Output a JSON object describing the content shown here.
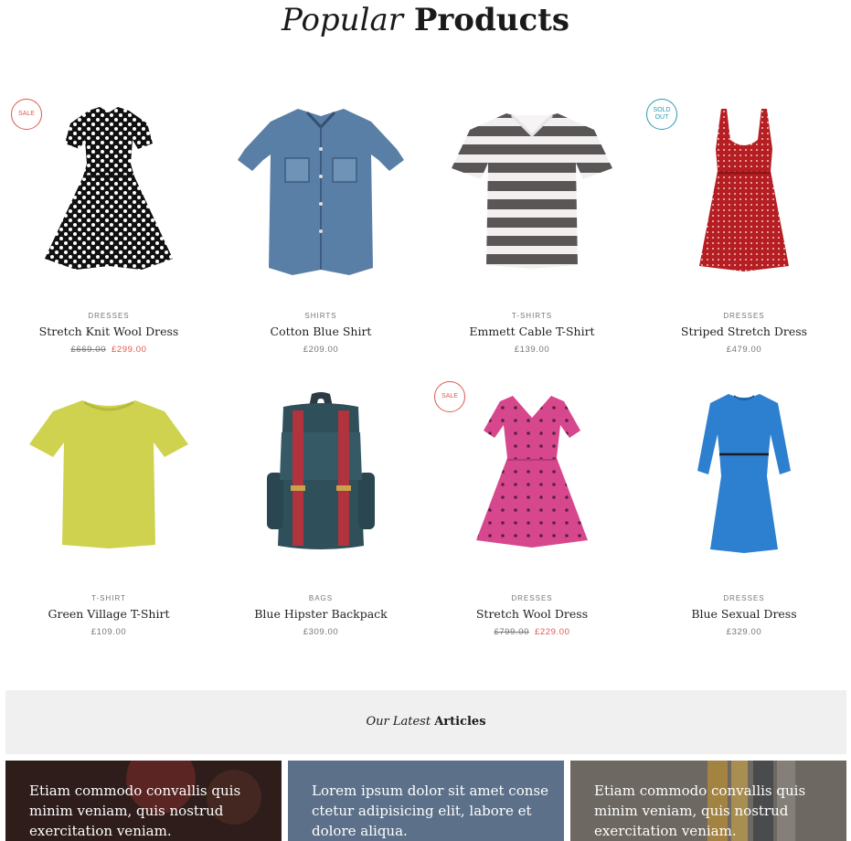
{
  "header": {
    "title_italic": "Popular",
    "title_bold": "Products"
  },
  "products": [
    {
      "category": "DRESSES",
      "name": "Stretch Knit Wool Dress",
      "old_price": "£669.00",
      "price": "£299.00",
      "badge": "SALE",
      "image": "polka-dot-dress-icon"
    },
    {
      "category": "SHIRTS",
      "name": "Cotton Blue Shirt",
      "price": "£209.00",
      "image": "denim-shirt-icon"
    },
    {
      "category": "T-SHIRTS",
      "name": "Emmett Cable T-Shirt",
      "price": "£139.00",
      "image": "striped-tshirt-icon"
    },
    {
      "category": "DRESSES",
      "name": "Striped Stretch Dress",
      "price": "£479.00",
      "badge": "SOLD OUT",
      "image": "red-dress-icon"
    },
    {
      "category": "T-SHIRT",
      "name": "Green Village T-Shirt",
      "price": "£109.00",
      "image": "yellow-tshirt-icon"
    },
    {
      "category": "BAGS",
      "name": "Blue Hipster Backpack",
      "price": "£309.00",
      "image": "backpack-icon"
    },
    {
      "category": "DRESSES",
      "name": "Stretch Wool Dress",
      "old_price": "£799.00",
      "price": "£229.00",
      "badge": "SALE",
      "image": "pink-dress-icon"
    },
    {
      "category": "DRESSES",
      "name": "Blue Sexual Dress",
      "price": "£329.00",
      "image": "blue-dress-icon"
    }
  ],
  "articles_section": {
    "title_italic": "Our Latest",
    "title_bold": "Articles"
  },
  "articles": [
    {
      "text": "Etiam commodo convallis quis minim veniam, quis nostrud exercitation veniam.",
      "background": "#3a2420"
    },
    {
      "text": "Lorem ipsum dolor sit amet conse ctetur adipisicing elit, labore et dolore aliqua.",
      "background": "#5c7189"
    },
    {
      "text": "Etiam commodo convallis quis minim veniam, quis nostrud exercitation veniam.",
      "background": "#7a746c"
    }
  ],
  "colors": {
    "sale": "#e0574f",
    "sold_out": "#2a9bb0",
    "articles_bar": "#f0f0f0"
  }
}
